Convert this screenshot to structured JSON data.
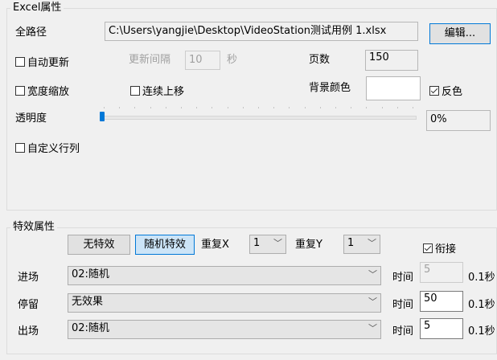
{
  "excel": {
    "title": "Excel属性",
    "path_label": "全路径",
    "path_value": "C:\\Users\\yangjie\\Desktop\\VideoStation测试用例 1.xlsx",
    "edit_button": "编辑...",
    "auto_update_label": "自动更新",
    "auto_update_checked": false,
    "interval_label": "更新间隔",
    "interval_value": "10",
    "interval_unit": "秒",
    "pages_label": "页数",
    "pages_value": "150",
    "width_zoom_label": "宽度缩放",
    "width_zoom_checked": false,
    "continuous_up_label": "连续上移",
    "continuous_up_checked": false,
    "bg_color_label": "背景颜色",
    "bg_color_value": "#ffffff",
    "invert_label": "反色",
    "invert_checked": true,
    "opacity_label": "透明度",
    "opacity_value": "0%",
    "opacity_fraction": 0,
    "custom_rowcol_label": "自定义行列",
    "custom_rowcol_checked": false
  },
  "effects": {
    "title": "特效属性",
    "no_effect_button": "无特效",
    "random_effect_button": "随机特效",
    "repeat_x_label": "重复X",
    "repeat_x_value": "1",
    "repeat_y_label": "重复Y",
    "repeat_y_value": "1",
    "join_label": "衔接",
    "join_checked": true,
    "time_label": "时间",
    "time_unit": "0.1秒",
    "rows": [
      {
        "label": "进场",
        "effect": "02:随机",
        "time": "5"
      },
      {
        "label": "停留",
        "effect": "无效果",
        "time": "50"
      },
      {
        "label": "出场",
        "effect": "02:随机",
        "time": "5"
      }
    ]
  }
}
